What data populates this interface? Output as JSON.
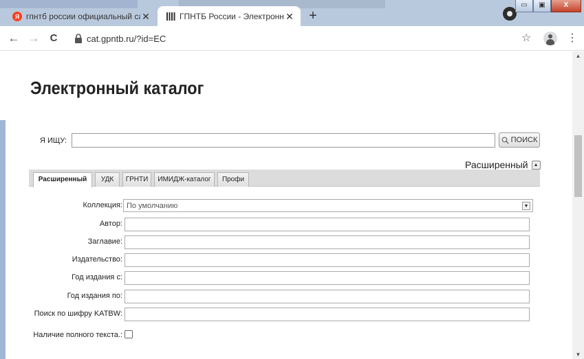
{
  "browser": {
    "tabs": [
      {
        "title": "гпнтб россии официальный сай",
        "active": false
      },
      {
        "title": "ГПНТБ России - Электронный к",
        "active": true
      }
    ],
    "new_tab": "+",
    "close_glyph": "✕",
    "url": "cat.gpntb.ru/?id=EC",
    "back_glyph": "←",
    "forward_glyph": "→",
    "reload_glyph": "C",
    "star_glyph": "☆",
    "menu_glyph": "⋮",
    "window_controls": {
      "minimize": "▭",
      "maximize": "▣",
      "close": "X"
    }
  },
  "page": {
    "heading": "Электронный каталог",
    "search": {
      "label": "Я ИЩУ:",
      "value": "",
      "button_label": "ПОИСК"
    },
    "mode_toggle": {
      "label": "Расширенный",
      "glyph": "▲"
    },
    "form_tabs": [
      {
        "label": "Расширенный",
        "active": true
      },
      {
        "label": "УДК",
        "active": false
      },
      {
        "label": "ГРНТИ",
        "active": false
      },
      {
        "label": "ИМИДЖ-каталог",
        "active": false
      },
      {
        "label": "Профи",
        "active": false
      }
    ],
    "fields": {
      "collection": {
        "label": "Коллекция:",
        "selected": "По умолчанию",
        "arrow": "▼"
      },
      "author": {
        "label": "Автор:",
        "value": ""
      },
      "title": {
        "label": "Заглавие:",
        "value": ""
      },
      "publisher": {
        "label": "Издательство:",
        "value": ""
      },
      "year_from": {
        "label": "Год издания с:",
        "value": ""
      },
      "year_to": {
        "label": "Год издания по:",
        "value": ""
      },
      "katbw": {
        "label": "Поиск по шифру KATBW:",
        "value": ""
      },
      "fulltext": {
        "label": "Наличие полного текста.:",
        "checked": false
      }
    },
    "scroll": {
      "up": "▲",
      "down": "▼"
    }
  },
  "colors": {
    "tabstrip": "#b9c9dd",
    "accent_leftbar": "#9fb6d6",
    "yandex_red": "#fc3f1d"
  }
}
